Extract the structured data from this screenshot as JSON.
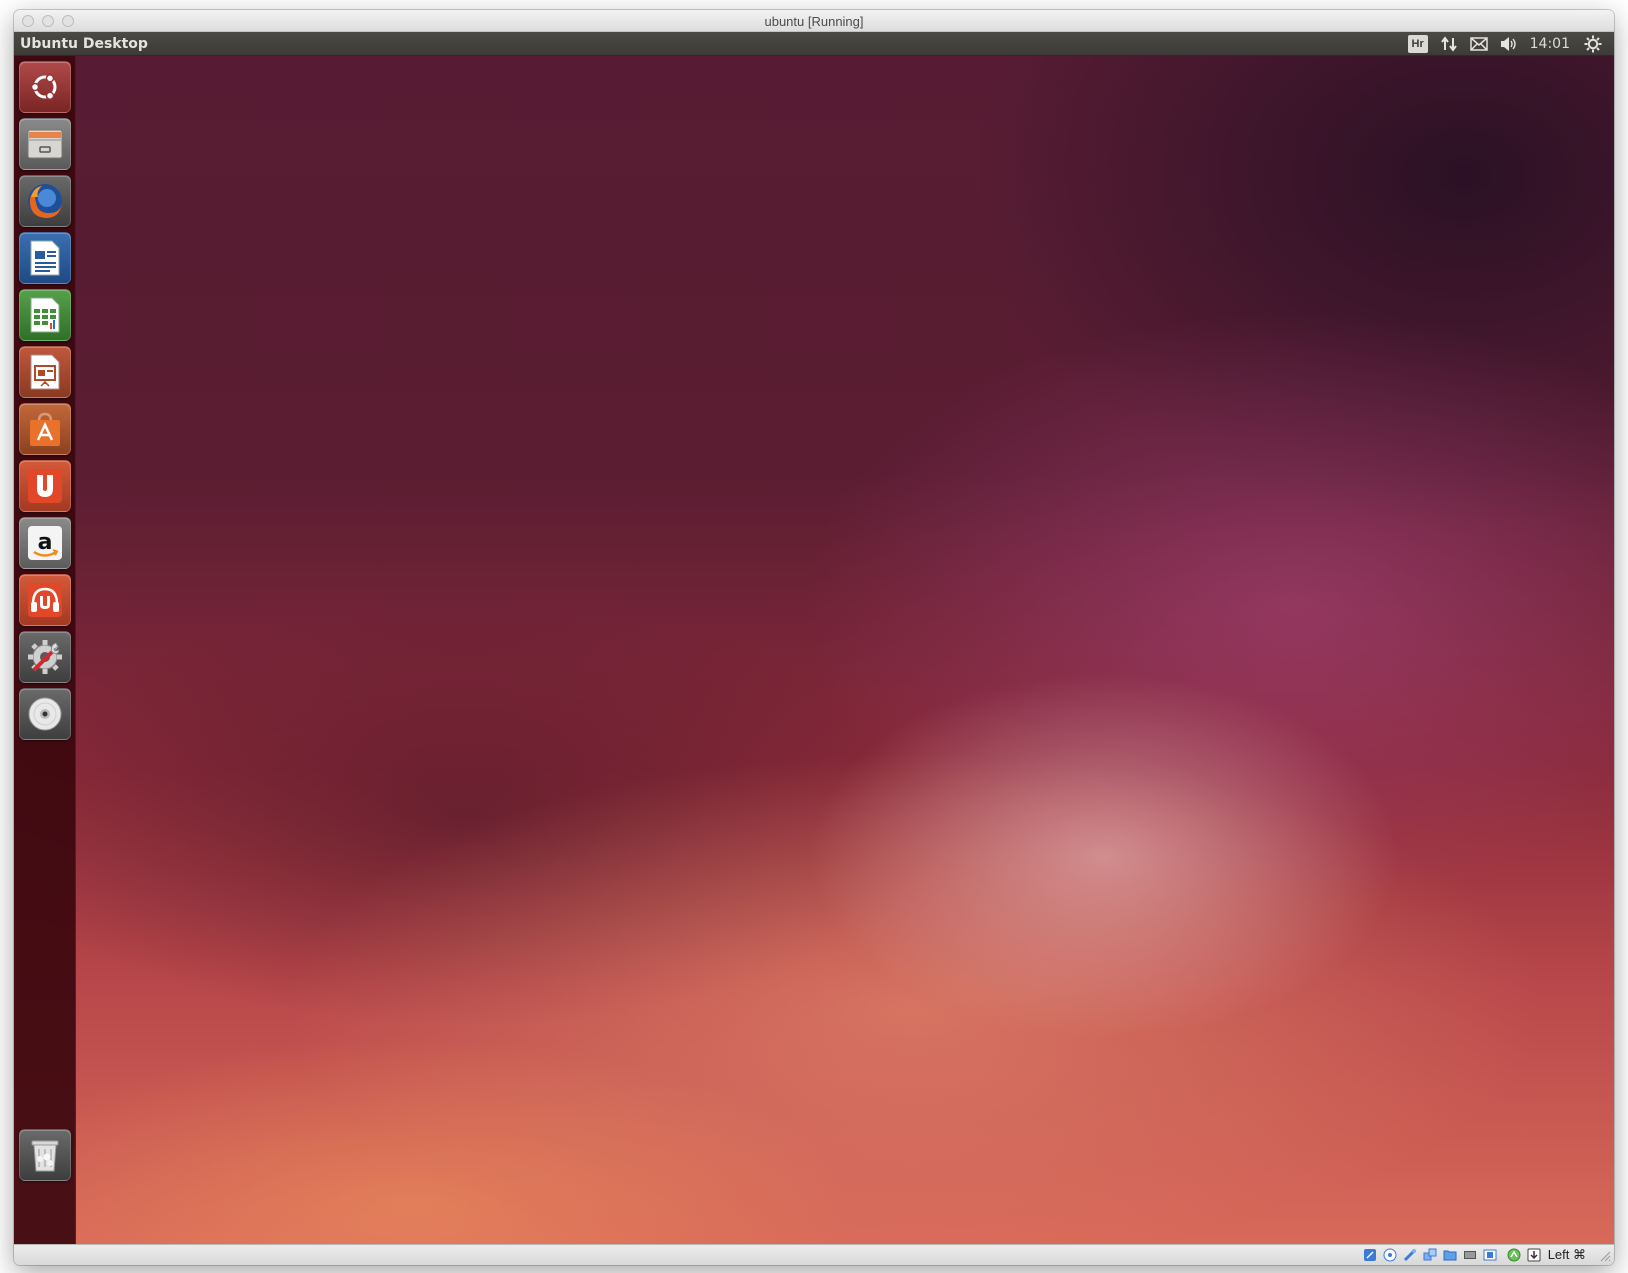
{
  "host_window": {
    "title": "ubuntu [Running]"
  },
  "top_panel": {
    "app_title": "Ubuntu Desktop",
    "keyboard_layout": "Hr",
    "clock": "14:01",
    "indicators": [
      "keyboard-layout-icon",
      "network-transfer-icon",
      "mail-icon",
      "volume-icon",
      "session-gear-icon"
    ]
  },
  "launcher": {
    "items": [
      {
        "name": "dash-home",
        "icon": "ubuntu-logo-icon"
      },
      {
        "name": "files",
        "icon": "file-cabinet-icon"
      },
      {
        "name": "firefox",
        "icon": "firefox-icon"
      },
      {
        "name": "libreoffice-writer",
        "icon": "writer-document-icon"
      },
      {
        "name": "libreoffice-calc",
        "icon": "calc-spreadsheet-icon"
      },
      {
        "name": "libreoffice-impress",
        "icon": "impress-presentation-icon"
      },
      {
        "name": "software-center",
        "icon": "shopping-bag-icon"
      },
      {
        "name": "ubuntu-one",
        "icon": "ubuntu-one-icon"
      },
      {
        "name": "amazon",
        "icon": "amazon-icon"
      },
      {
        "name": "ubuntu-one-music",
        "icon": "music-headphones-icon"
      },
      {
        "name": "system-settings",
        "icon": "settings-wrench-icon"
      },
      {
        "name": "optical-disc",
        "icon": "disc-icon"
      }
    ],
    "trash": {
      "name": "trash",
      "icon": "trash-icon"
    }
  },
  "status_bar": {
    "host_key": "Left ⌘",
    "icons": [
      "hard-disk-icon",
      "optical-drive-icon",
      "usb-icon",
      "network-icon",
      "shared-folder-icon",
      "display-icon",
      "video-capture-icon",
      "mouse-integration-icon",
      "keyboard-capture-icon"
    ]
  },
  "colors": {
    "panel_bg": "#3c3b37",
    "launcher_bg": "#3c080e",
    "wallpaper_base": "#5a1d32",
    "wallpaper_glow": "#e8a0a0"
  }
}
